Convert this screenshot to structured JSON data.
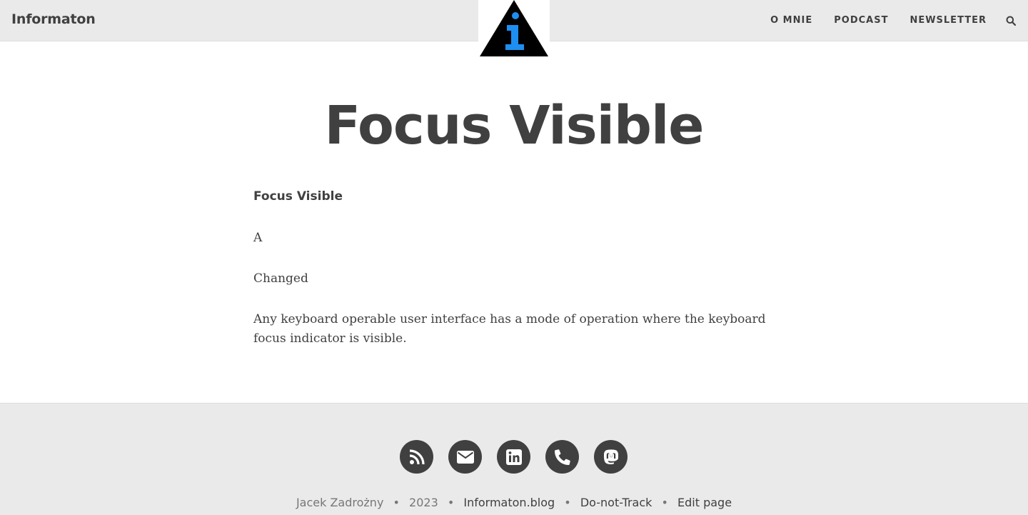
{
  "navbar": {
    "brand": "Informaton",
    "links": [
      "O MNIE",
      "PODCAST",
      "NEWSLETTER"
    ],
    "search_icon": "search-icon",
    "logo_icon": "info-triangle-logo",
    "colors": {
      "background": "#eaeaea",
      "logo_accent": "#1e8ff0"
    }
  },
  "post": {
    "title": "Focus Visible",
    "subheading": "Focus Visible",
    "paragraphs": [
      "A",
      "Changed",
      "Any keyboard operable user interface has a mode of operation where the keyboard focus indicator is visible."
    ]
  },
  "footer": {
    "social": [
      {
        "icon": "rss-icon"
      },
      {
        "icon": "envelope-icon"
      },
      {
        "icon": "linkedin-icon"
      },
      {
        "icon": "phone-icon"
      },
      {
        "icon": "mastodon-icon"
      }
    ],
    "author": "Jacek Zadrożny",
    "year": "2023",
    "site": "Informaton.blog",
    "dnt": "Do-not-Track",
    "edit": "Edit page"
  }
}
